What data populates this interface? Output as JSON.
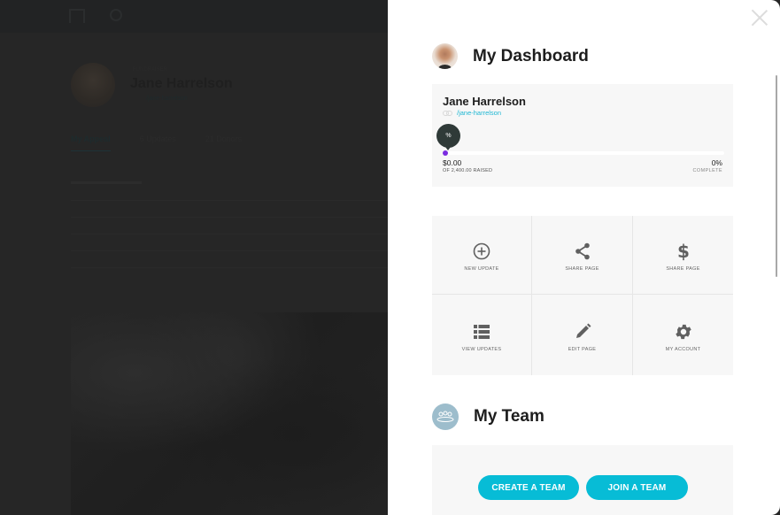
{
  "background_page": {
    "profile_label": "FUNDRAISER",
    "name": "Jane Harrelson",
    "slug": "/jane-harrelson",
    "tabs": [
      {
        "label": "My Appeal",
        "active": true
      },
      {
        "label": "6 Updates",
        "active": false
      },
      {
        "label": "21 Donors",
        "active": false
      }
    ]
  },
  "panel": {
    "close_icon": "close-icon",
    "dashboard": {
      "title": "My Dashboard",
      "profile": {
        "name": "Jane Harrelson",
        "slug": "/jane-harrelson",
        "percent_bubble": "%",
        "progress_fraction": 0,
        "raised_amount": "$0.00",
        "raised_label": "OF 2,400.00 RAISED",
        "complete_value": "0%",
        "complete_label": "COMPLETE",
        "progress_color": "#7b2ce0"
      },
      "actions": [
        {
          "label": "NEW UPDATE",
          "icon": "plus-circle-icon"
        },
        {
          "label": "SHARE PAGE",
          "icon": "share-icon"
        },
        {
          "label": "SHARE PAGE",
          "icon": "dollar-icon"
        },
        {
          "label": "VIEW UPDATES",
          "icon": "list-icon"
        },
        {
          "label": "EDIT PAGE",
          "icon": "pencil-icon"
        },
        {
          "label": "MY ACCOUNT",
          "icon": "gear-icon"
        }
      ]
    },
    "team": {
      "title": "My Team",
      "create_button": "CREATE A TEAM",
      "join_button": "JOIN A TEAM",
      "accent_color": "#07bcd6"
    }
  }
}
